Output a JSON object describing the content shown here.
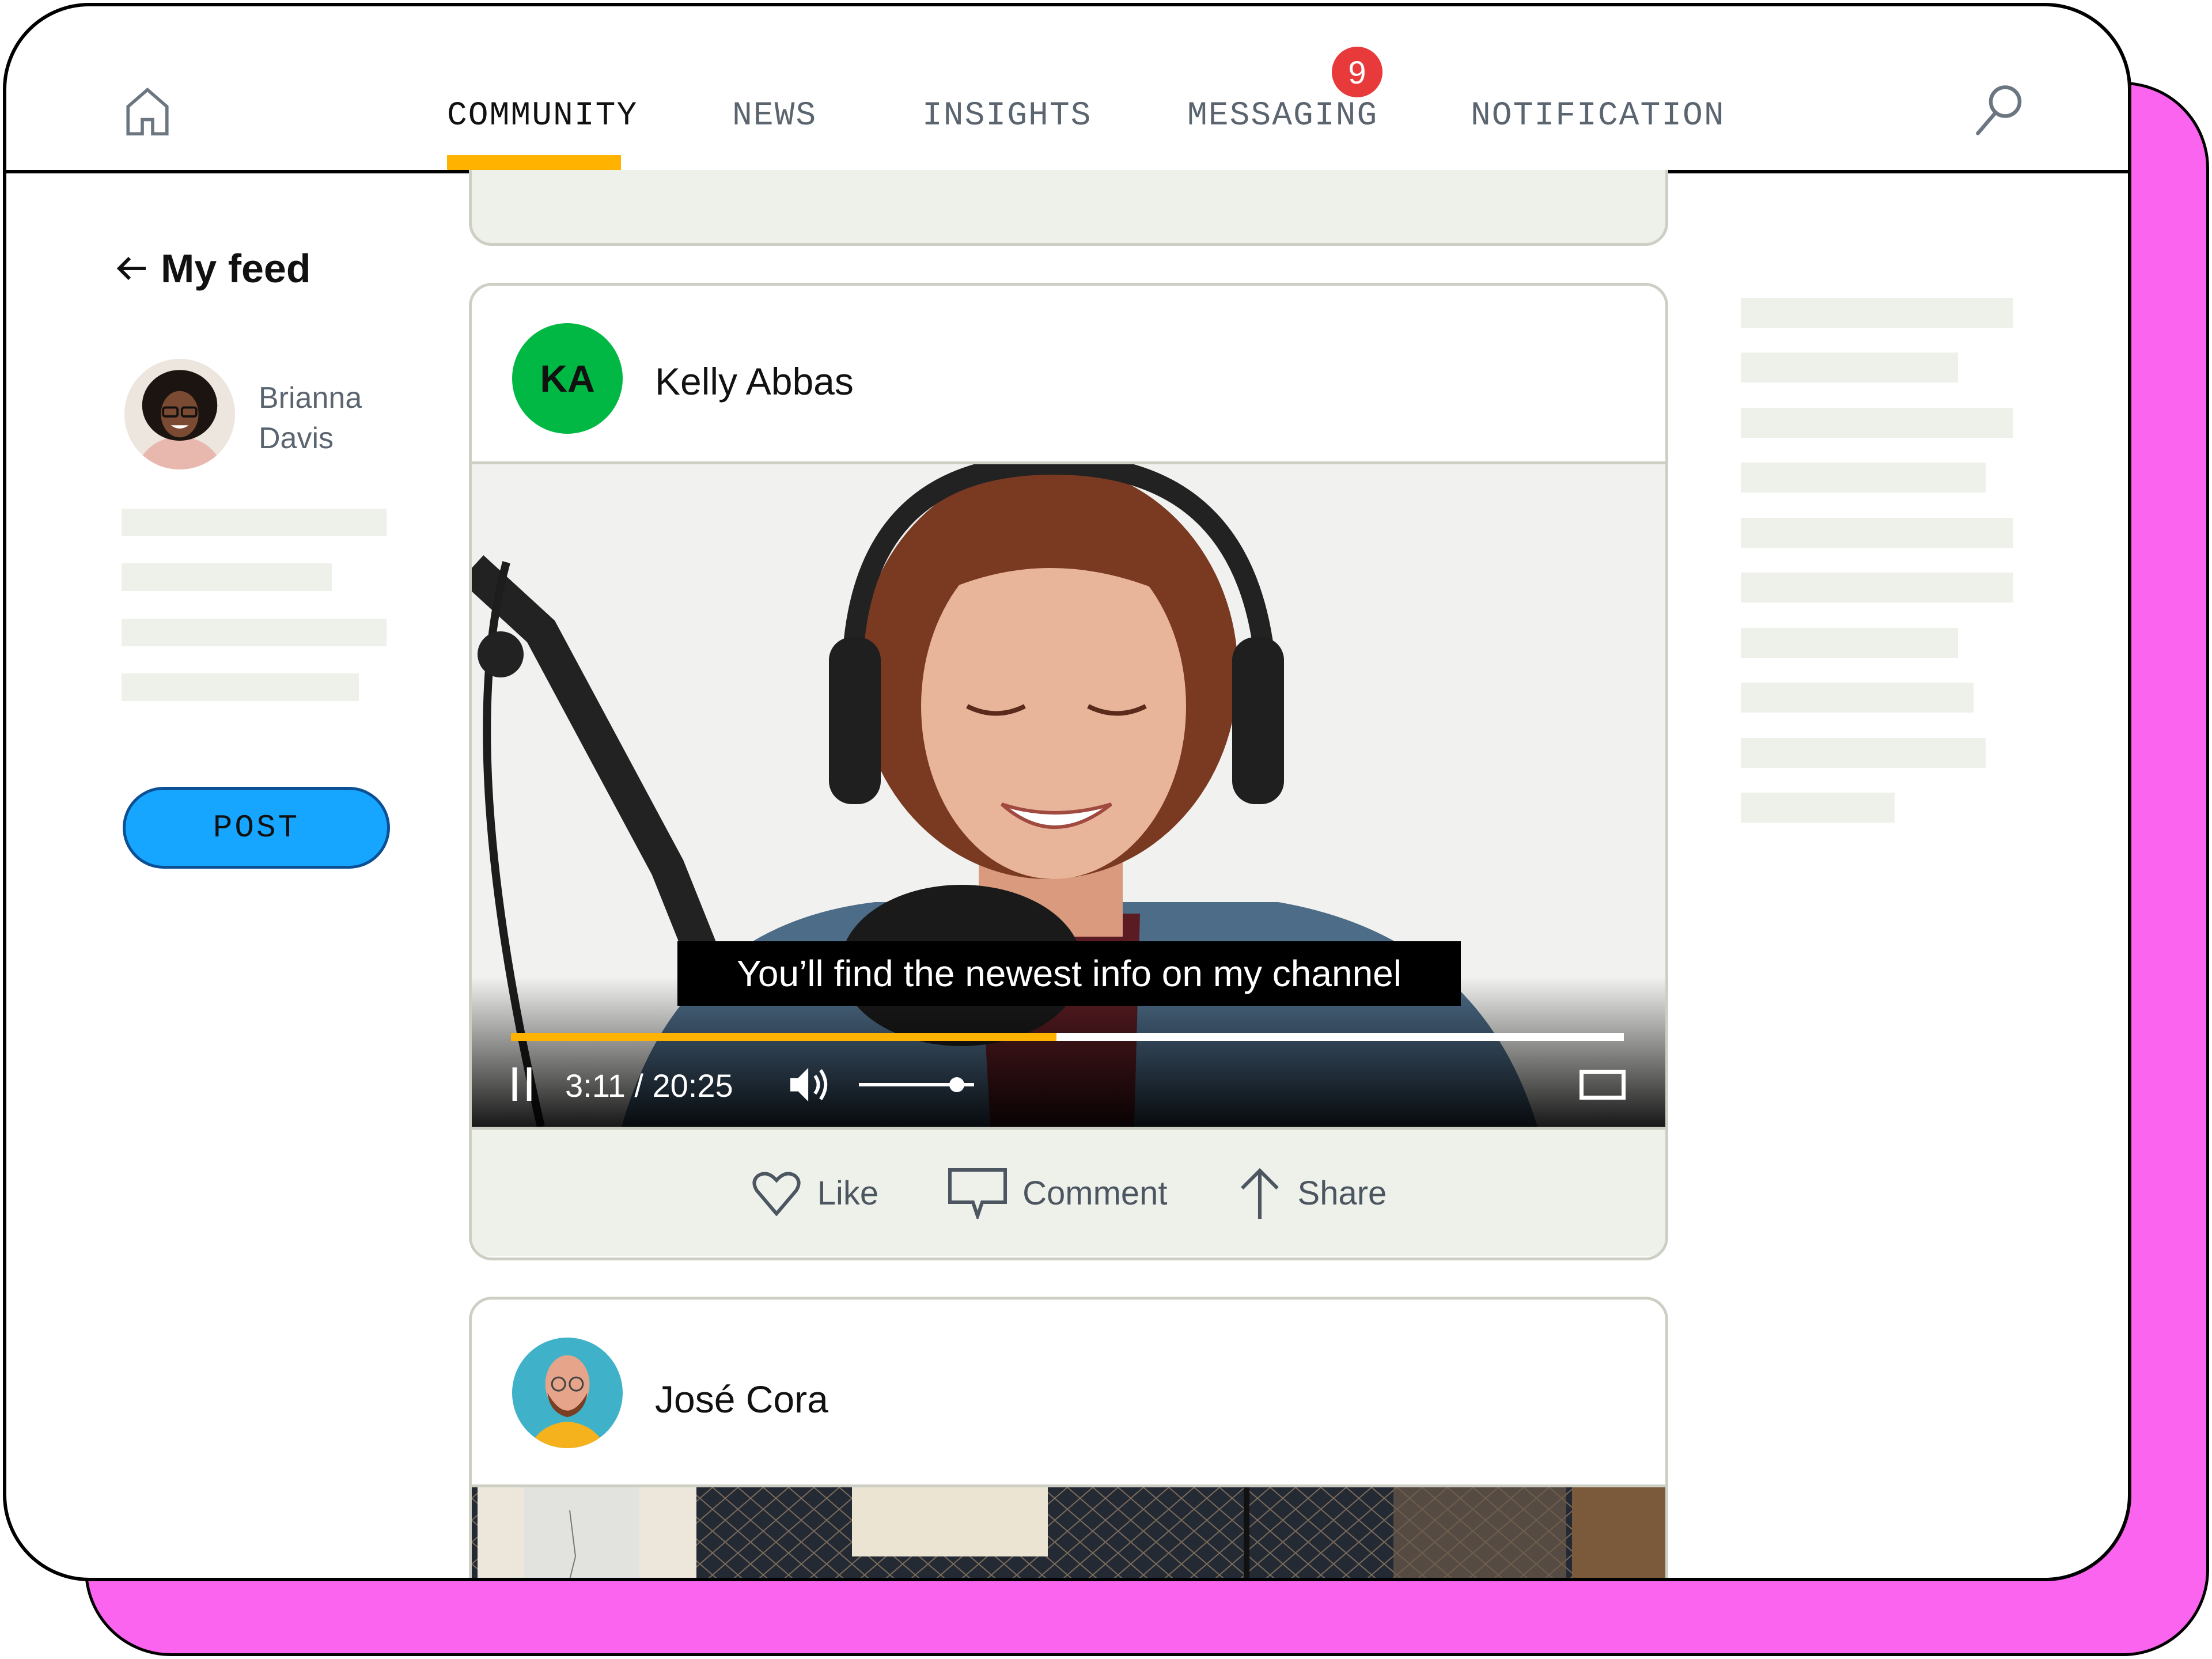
{
  "nav": {
    "home_icon": "home-icon",
    "tabs": [
      {
        "label": "COMMUNITY",
        "active": true
      },
      {
        "label": "NEWS",
        "active": false
      },
      {
        "label": "INSIGHTS",
        "active": false
      },
      {
        "label": "MESSAGING",
        "active": false,
        "badge": "9"
      },
      {
        "label": "NOTIFICATION",
        "active": false
      }
    ],
    "search_icon": "search-icon",
    "accent_color": "#ffb300",
    "badge_color": "#e8393b"
  },
  "sidebar": {
    "back_label": "My feed",
    "user": {
      "first_name": "Brianna",
      "last_name": "Davis"
    },
    "post_button": "POST",
    "post_button_color": "#16a6ff"
  },
  "feed": {
    "posts": [
      {
        "author": "Kelly Abbas",
        "initials": "KA",
        "avatar_color": "#00b843",
        "video": {
          "caption": "You’ll find the newest info on my channel",
          "current_time": "3:11",
          "duration": "20:25",
          "time_display": "3:11 / 20:25",
          "progress_fraction": 0.49,
          "volume_fraction": 0.85
        },
        "actions": [
          {
            "label": "Like",
            "icon": "heart-icon"
          },
          {
            "label": "Comment",
            "icon": "comment-icon"
          },
          {
            "label": "Share",
            "icon": "share-arrow-icon"
          }
        ]
      },
      {
        "author": "José Cora"
      }
    ]
  }
}
